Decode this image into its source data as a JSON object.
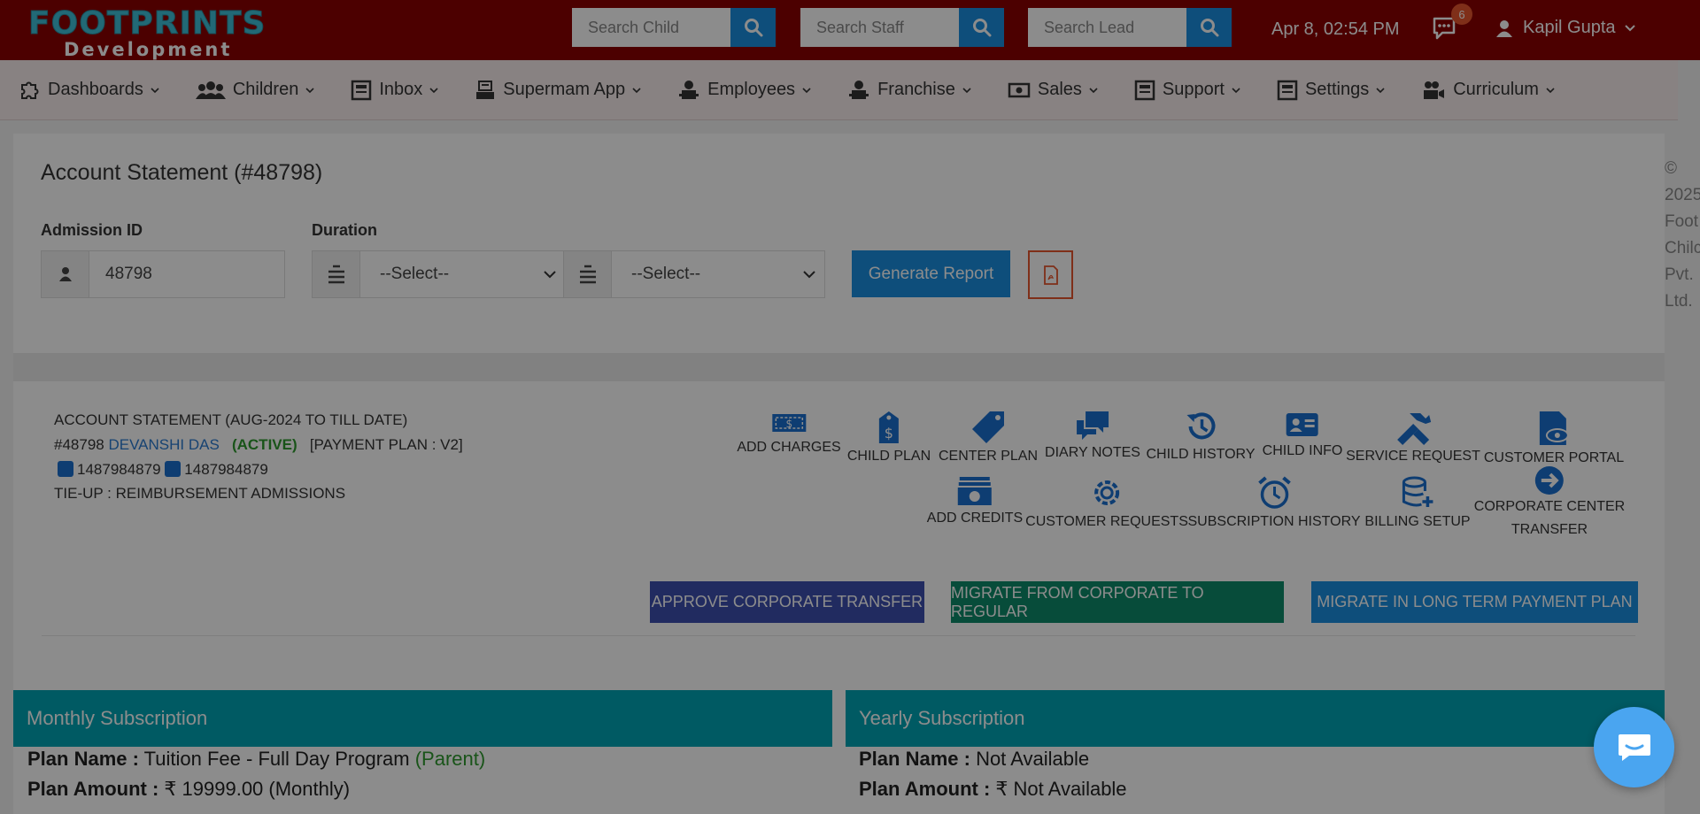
{
  "brand": {
    "main": "FOOTPRINTS",
    "sub": "Development"
  },
  "search": {
    "child_placeholder": "Search Child",
    "staff_placeholder": "Search Staff",
    "lead_placeholder": "Search Lead"
  },
  "header": {
    "datetime": "Apr 8, 02:54 PM",
    "notification_count": "6",
    "user_name": "Kapil Gupta"
  },
  "nav": [
    {
      "label": "Dashboards"
    },
    {
      "label": "Children"
    },
    {
      "label": "Inbox"
    },
    {
      "label": "Supermam App"
    },
    {
      "label": "Employees"
    },
    {
      "label": "Franchise"
    },
    {
      "label": "Sales"
    },
    {
      "label": "Support"
    },
    {
      "label": "Settings"
    },
    {
      "label": "Curriculum"
    }
  ],
  "page": {
    "title": "Account Statement (#48798)",
    "admission_label": "Admission ID",
    "admission_value": "48798",
    "duration_label": "Duration",
    "select_from": "--Select--",
    "select_to": "--Select--",
    "generate_label": "Generate Report"
  },
  "account": {
    "heading": "ACCOUNT STATEMENT (AUG-2024 TO TILL DATE)",
    "id": "#48798",
    "child_name": "DEVANSHI DAS",
    "status": "(ACTIVE)",
    "plan": "[PAYMENT PLAN : V2]",
    "phone1": "1487984879",
    "phone2": "1487984879",
    "tieup": "TIE-UP : REIMBURSEMENT ADMISSIONS"
  },
  "actions_row1": [
    {
      "label": "ADD CHARGES",
      "icon": "money-icon"
    },
    {
      "label": "CHILD PLAN",
      "icon": "dollar-tag-icon"
    },
    {
      "label": "CENTER PLAN",
      "icon": "tag-icon"
    },
    {
      "label": "DIARY NOTES",
      "icon": "comments-icon"
    },
    {
      "label": "CHILD HISTORY",
      "icon": "history-icon"
    },
    {
      "label": "CHILD INFO",
      "icon": "id-card-icon"
    },
    {
      "label": "SERVICE REQUEST",
      "icon": "tools-icon"
    },
    {
      "label": "CUSTOMER PORTAL",
      "icon": "file-eye-icon"
    }
  ],
  "actions_row2": [
    {
      "label": "ADD CREDITS",
      "icon": "cash-stack-icon"
    },
    {
      "label": "CUSTOMER REQUESTS",
      "icon": "gear-icon"
    },
    {
      "label": "SUBSCRIPTION HISTORY",
      "icon": "alarm-clock-icon"
    },
    {
      "label": "BILLING SETUP",
      "icon": "database-plus-icon"
    },
    {
      "label": "CORPORATE CENTER",
      "label2": "TRANSFER",
      "icon": "arrow-circle-icon"
    }
  ],
  "buttons": {
    "approve": "APPROVE CORPORATE TRANSFER",
    "migrate_regular": "MIGRATE FROM CORPORATE TO REGULAR",
    "migrate_long": "MIGRATE IN LONG TERM PAYMENT PLAN"
  },
  "monthly": {
    "title": "Monthly Subscription",
    "plan_name_label": "Plan Name :",
    "plan_name": "Tuition Fee - Full Day Program",
    "plan_name_tag": "(Parent)",
    "plan_amount_label": "Plan Amount :",
    "plan_amount": "₹ 19999.00 (Monthly)"
  },
  "yearly": {
    "title": "Yearly Subscription",
    "plan_name_label": "Plan Name :",
    "plan_name": "Not Available",
    "plan_amount_label": "Plan Amount :",
    "plan_amount": "₹ Not Available"
  },
  "copyright": [
    "©",
    "2025",
    "Foot",
    "Chilc",
    "Pvt.",
    "Ltd."
  ],
  "colors": {
    "topbar": "#8b0000",
    "accent": "#1a8fe0",
    "teal": "#00a5b5",
    "approve": "#3d4fb0",
    "migrate_regular": "#0e8a6a",
    "migrate_long": "#1a8fe0"
  }
}
